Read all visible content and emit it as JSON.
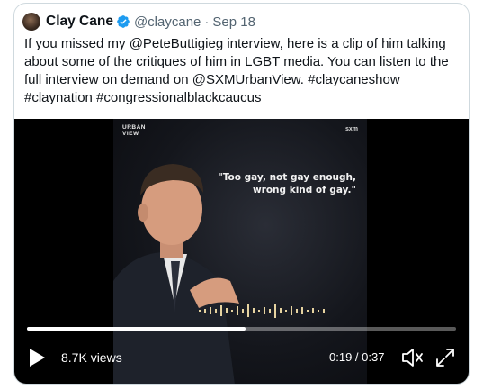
{
  "tweet": {
    "author": {
      "name": "Clay Cane",
      "handle": "@claycane",
      "separator": "·",
      "date": "Sep 18"
    },
    "text": "If you missed my @PeteButtigieg interview, here is a clip of him talking about some of the critiques of him in LGBT media. You can listen to the full interview on demand on @SXMUrbanView. #claycaneshow #claynation #congressionalblackcaucus"
  },
  "video": {
    "logo_top": "URBAN",
    "logo_bottom": "VIEW",
    "network": "sxm",
    "quote_line1": "\"Too gay, not gay enough,",
    "quote_line2": "wrong kind of gay.\"",
    "views": "8.7K views",
    "time": "0:19 / 0:37",
    "progress": 0.51
  },
  "colors": {
    "verified": "#1d9bf0",
    "text": "#0f1419",
    "muted": "#536471",
    "border": "#cfd9de"
  }
}
